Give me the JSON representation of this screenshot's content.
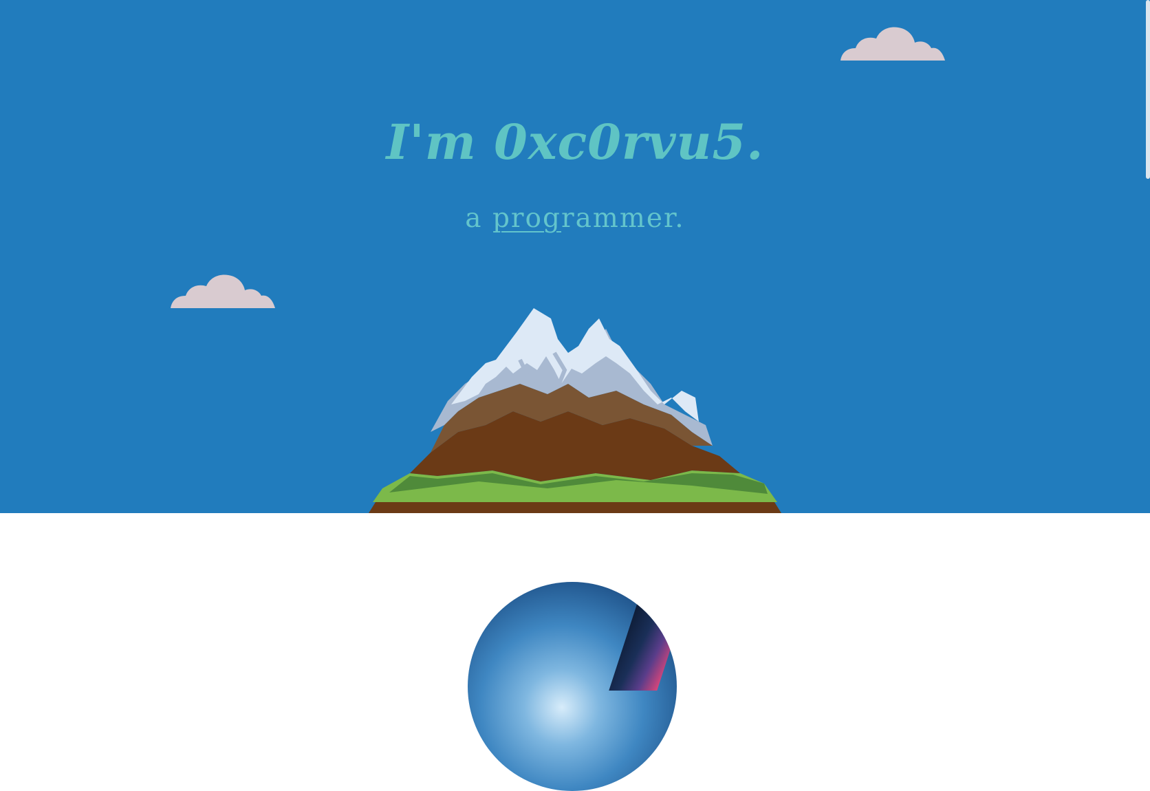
{
  "hero": {
    "title": "I'm 0xc0rvu5.",
    "subtitle_prefix": "a ",
    "subtitle_typed": "prog",
    "subtitle_rest": "rammer.",
    "colors": {
      "sky": "#217cbd",
      "title": "#5fc4c4",
      "cloud": "#d9cbd0"
    }
  },
  "icons": {
    "cloud": "cloud-icon",
    "mountain": "mountain-illustration",
    "avatar": "profile-avatar"
  }
}
